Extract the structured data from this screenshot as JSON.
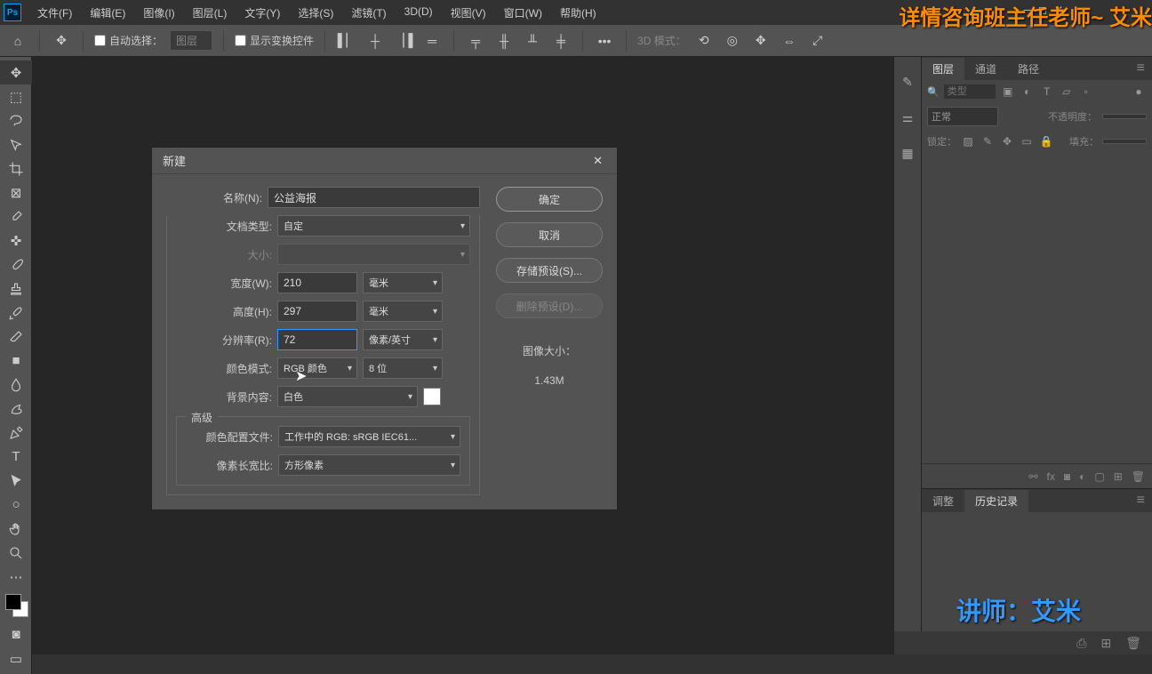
{
  "menu": [
    "文件(F)",
    "编辑(E)",
    "图像(I)",
    "图层(L)",
    "文字(Y)",
    "选择(S)",
    "滤镜(T)",
    "3D(D)",
    "视图(V)",
    "窗口(W)",
    "帮助(H)"
  ],
  "options_bar": {
    "auto_select": "自动选择：",
    "layer_select": "图层",
    "show_transform": "显示变换控件",
    "mode3d": "3D 模式："
  },
  "dialog": {
    "title": "新建",
    "name_label": "名称(N):",
    "name_value": "公益海报",
    "doctype_label": "文档类型:",
    "doctype_value": "自定",
    "size_label": "大小:",
    "width_label": "宽度(W):",
    "width_value": "210",
    "height_label": "高度(H):",
    "height_value": "297",
    "unit_mm": "毫米",
    "res_label": "分辨率(R):",
    "res_value": "72",
    "res_unit": "像素/英寸",
    "color_mode_label": "颜色模式:",
    "color_mode_value": "RGB 颜色",
    "bit_depth": "8 位",
    "bg_label": "背景内容:",
    "bg_value": "白色",
    "advanced": "高级",
    "profile_label": "颜色配置文件:",
    "profile_value": "工作中的 RGB: sRGB IEC61...",
    "aspect_label": "像素长宽比:",
    "aspect_value": "方形像素",
    "btn_ok": "确定",
    "btn_cancel": "取消",
    "btn_save_preset": "存储预设(S)...",
    "btn_del_preset": "删除预设(D)...",
    "img_size_label": "图像大小：",
    "img_size_value": "1.43M"
  },
  "panels": {
    "tabs": [
      "图层",
      "通道",
      "路径"
    ],
    "search_placeholder": "类型",
    "blend_mode": "正常",
    "opacity_label": "不透明度：",
    "lock_label": "锁定：",
    "fill_label": "填充：",
    "history_tabs": [
      "调整",
      "历史记录"
    ]
  },
  "overlay": {
    "top_text": "详情咨询班主任老师~ 艾米",
    "bottom_text": "讲师：艾米"
  }
}
